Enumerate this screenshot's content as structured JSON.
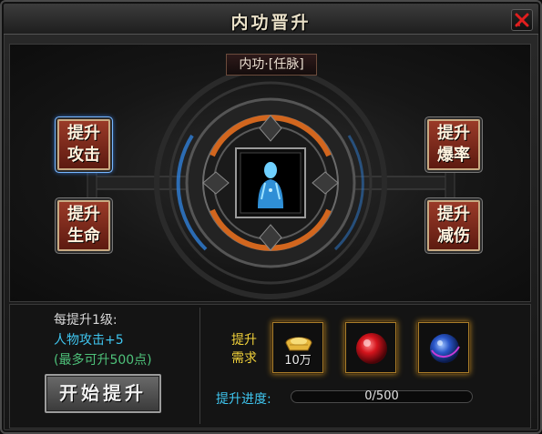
{
  "window": {
    "title": "内功晋升",
    "close_icon": "close-x-icon"
  },
  "stage": {
    "subtitle": "内功·[任脉]",
    "center_icon": "meridian-body-icon",
    "buttons": {
      "attack": {
        "line1": "提升",
        "line2": "攻击",
        "active": true
      },
      "life": {
        "line1": "提升",
        "line2": "生命",
        "active": false
      },
      "crit": {
        "line1": "提升",
        "line2": "爆率",
        "active": false
      },
      "reduce": {
        "line1": "提升",
        "line2": "减伤",
        "active": false
      }
    }
  },
  "info": {
    "per_level": "每提升1级:",
    "attack_bonus": "人物攻击+5",
    "max_points": "(最多可升500点)",
    "start_label": "开始提升"
  },
  "requirements": {
    "label_line1": "提升",
    "label_line2": "需求",
    "items": [
      {
        "icon": "gold-ingot-icon",
        "amount": "10万"
      },
      {
        "icon": "red-orb-icon",
        "amount": ""
      },
      {
        "icon": "blue-orb-icon",
        "amount": ""
      }
    ]
  },
  "progress": {
    "label": "提升进度:",
    "current": 0,
    "max": 500,
    "text": "0/500"
  },
  "colors": {
    "accent_cyan": "#3fc6f0",
    "accent_green": "#4ec27a",
    "accent_yellow": "#f2d23a",
    "button_red": "#8a2e20",
    "gold_border": "#aa7d2a"
  }
}
